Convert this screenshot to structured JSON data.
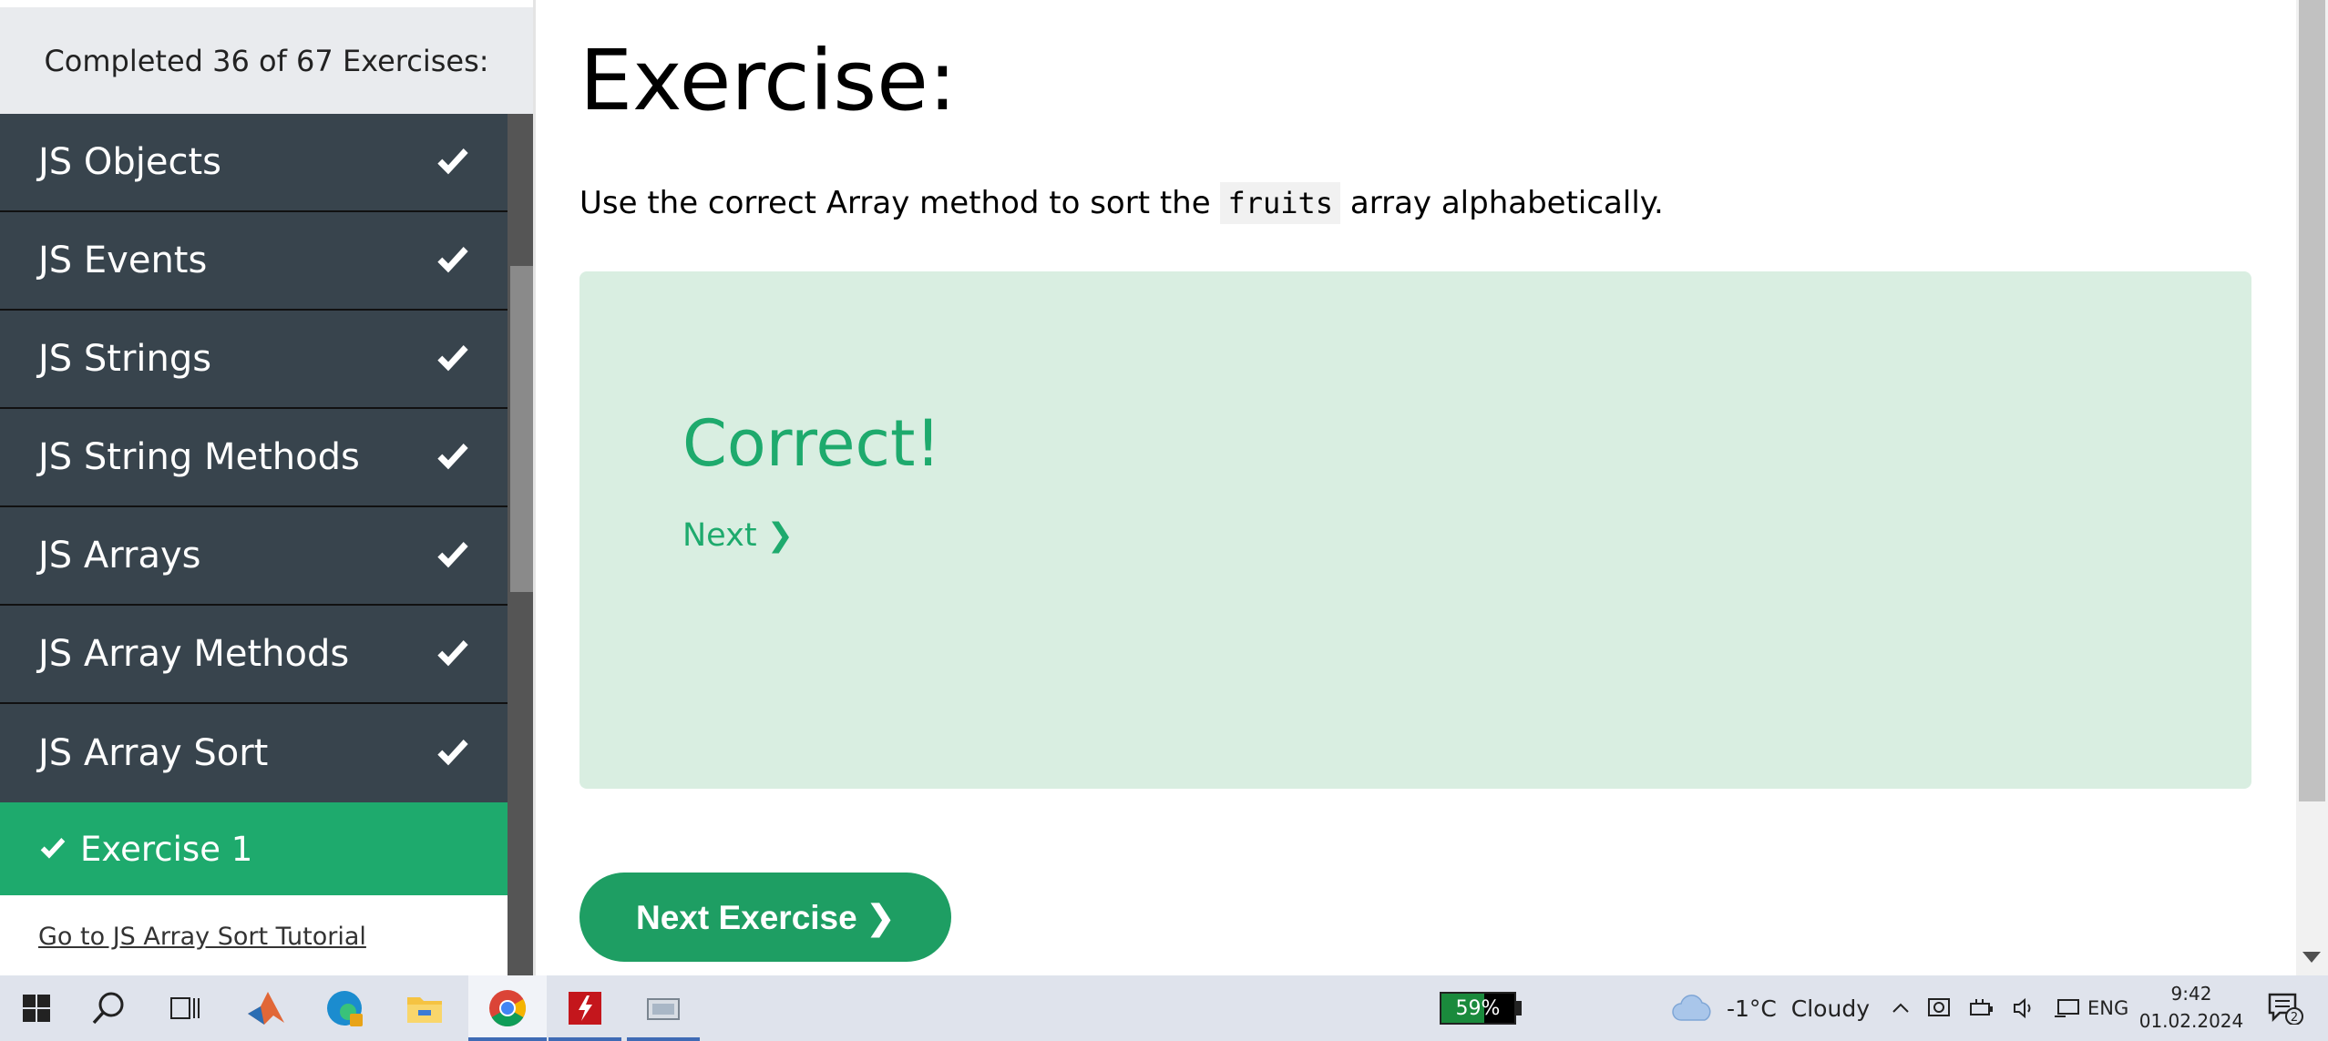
{
  "sidebar": {
    "progress_text": "Completed 36 of 67 Exercises:",
    "items": [
      {
        "label": "JS Objects"
      },
      {
        "label": "JS Events"
      },
      {
        "label": "JS Strings"
      },
      {
        "label": "JS String Methods"
      },
      {
        "label": "JS Arrays"
      },
      {
        "label": "JS Array Methods"
      },
      {
        "label": "JS Array Sort"
      }
    ],
    "active_exercise": "Exercise 1",
    "tutorial_link": "Go to JS Array Sort Tutorial"
  },
  "main": {
    "title": "Exercise:",
    "description_before": "Use the correct Array method to sort the ",
    "description_code": "fruits",
    "description_after": " array alphabetically.",
    "result": {
      "heading": "Correct!",
      "next_link": "Next ❯"
    },
    "next_exercise_button": "Next Exercise ❯"
  },
  "taskbar": {
    "apps": [
      "start-icon",
      "search-icon",
      "task-view-icon",
      "matlab-icon",
      "edge-icon",
      "file-explorer-icon",
      "chrome-icon",
      "acrobat-icon",
      "app-icon"
    ],
    "active_app": "chrome-icon",
    "battery_percent": "59%",
    "battery_level": 0.59,
    "weather_text": "-1°C  Cloudy",
    "language": "ENG",
    "time": "9:42",
    "date": "01.02.2024",
    "notification_count": "2"
  },
  "colors": {
    "sidebar_item_bg": "#38444d",
    "accent_green": "#1eaa6d",
    "result_bg": "#d9eee1",
    "button_green": "#1e9e63"
  }
}
